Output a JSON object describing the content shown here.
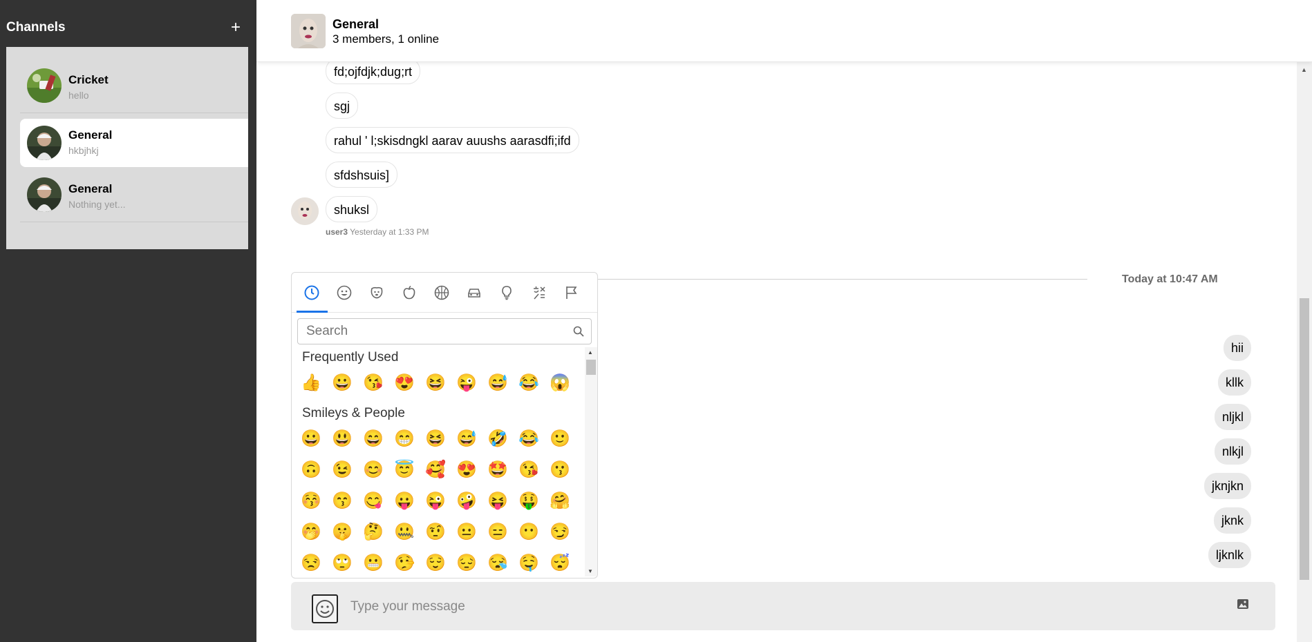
{
  "sidebar": {
    "title": "Channels",
    "add_label": "+",
    "channels": [
      {
        "name": "Cricket",
        "preview": "hello",
        "active": false
      },
      {
        "name": "General",
        "preview": "hkbjhkj",
        "active": true
      },
      {
        "name": "General",
        "preview": "Nothing yet...",
        "active": false
      }
    ]
  },
  "header": {
    "title": "General",
    "subtitle": "3 members, 1 online"
  },
  "messages": {
    "received": [
      "fd;ojfdjk;dug;rt",
      "sgj",
      "rahul ' l;skisdngkl aarav auushs aarasdfi;ifd",
      "sfdshsuis]",
      "shuksl"
    ],
    "meta_user": "user3",
    "meta_time": "Yesterday at 1:33 PM",
    "divider_label": "Today at 10:47 AM",
    "sent": [
      "hii",
      "kllk",
      "nljkl",
      "nlkjl",
      "jknjkn",
      "jknk",
      "ljknlk"
    ]
  },
  "composer": {
    "placeholder": "Type your message"
  },
  "emoji_picker": {
    "categories": [
      "recent-icon",
      "smiley-icon",
      "animal-icon",
      "food-icon",
      "activity-icon",
      "travel-icon",
      "objects-icon",
      "symbols-icon",
      "flags-icon"
    ],
    "search_placeholder": "Search",
    "frequently_used_label": "Frequently Used",
    "frequently_used": [
      "👍",
      "😀",
      "😘",
      "😍",
      "😆",
      "😜",
      "😅",
      "😂",
      "😱"
    ],
    "smileys_label": "Smileys & People",
    "smileys": [
      [
        "😀",
        "😃",
        "😄",
        "😁",
        "😆",
        "😅",
        "🤣",
        "😂",
        "🙂"
      ],
      [
        "🙃",
        "😉",
        "😊",
        "😇",
        "🥰",
        "😍",
        "🤩",
        "😘",
        "😗"
      ],
      [
        "😚",
        "😙",
        "😋",
        "😛",
        "😜",
        "🤪",
        "😝",
        "🤑",
        "🤗"
      ],
      [
        "🤭",
        "🤫",
        "🤔",
        "🤐",
        "🤨",
        "😐",
        "😑",
        "😶",
        "😏"
      ],
      [
        "😒",
        "🙄",
        "😬",
        "🤥",
        "😌",
        "😔",
        "😪",
        "🤤",
        "😴"
      ]
    ]
  },
  "colors": {
    "sidebar_bg": "#333333",
    "channel_list_bg": "#dbdbdb",
    "accent": "#1a73e8",
    "sent_bubble": "#e9e9e9",
    "composer_bg": "#ebebeb"
  }
}
